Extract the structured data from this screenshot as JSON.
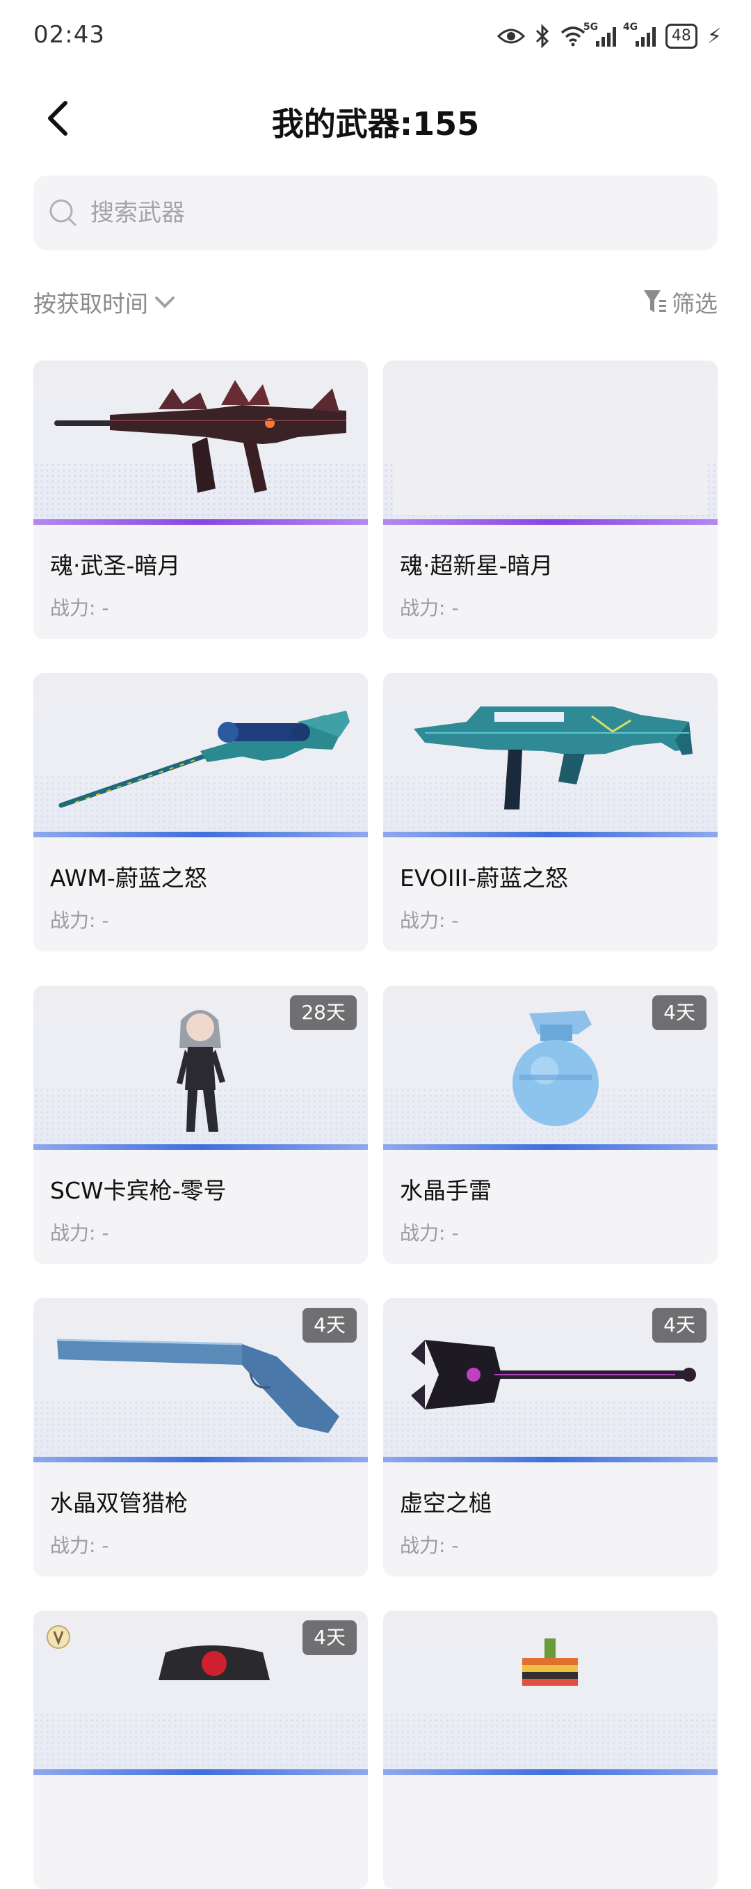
{
  "status_bar": {
    "time": "02:43",
    "net1": "5G",
    "net2": "4G",
    "battery": "48"
  },
  "header": {
    "title": "我的武器:155"
  },
  "search": {
    "placeholder": "搜索武器"
  },
  "toolbar": {
    "sort_label": "按获取时间",
    "filter_label": "筛选"
  },
  "weapons": [
    {
      "name": "魂·武圣-暗月",
      "power": "战力: -",
      "days": "",
      "rarity": "purple",
      "icon": "assault-rifle-icon"
    },
    {
      "name": "魂·超新星-暗月",
      "power": "战力: -",
      "days": "",
      "rarity": "purple",
      "icon": "image-placeholder"
    },
    {
      "name": "AWM-蔚蓝之怒",
      "power": "战力: -",
      "days": "",
      "rarity": "blue",
      "icon": "sniper-rifle-icon"
    },
    {
      "name": "EVOIII-蔚蓝之怒",
      "power": "战力: -",
      "days": "",
      "rarity": "blue",
      "icon": "smg-icon"
    },
    {
      "name": "SCW卡宾枪-零号",
      "power": "战力: -",
      "days": "28天",
      "rarity": "blue",
      "icon": "character-icon"
    },
    {
      "name": "水晶手雷",
      "power": "战力: -",
      "days": "4天",
      "rarity": "blue",
      "icon": "grenade-icon"
    },
    {
      "name": "水晶双管猎枪",
      "power": "战力: -",
      "days": "4天",
      "rarity": "blue",
      "icon": "shotgun-icon"
    },
    {
      "name": "虚空之槌",
      "power": "战力: -",
      "days": "4天",
      "rarity": "blue",
      "icon": "hammer-icon"
    },
    {
      "name": "",
      "power": "",
      "days": "4天",
      "rarity": "blue",
      "icon": "mech-weapon-icon"
    },
    {
      "name": "",
      "power": "",
      "days": "",
      "rarity": "blue",
      "icon": "striped-item-icon"
    }
  ],
  "colors": {
    "purple_bar": "#8a45e0",
    "blue_bar": "#3f6fdc",
    "badge_bg": "#6f6f72",
    "card_bg": "#f4f4f6"
  }
}
